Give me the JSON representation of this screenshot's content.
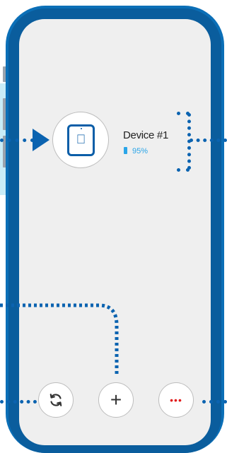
{
  "device": {
    "name": "Device #1",
    "battery_percent": "95%",
    "battery_level": 0.95,
    "icon": "tablet-apple-icon"
  },
  "toolbar": {
    "buttons": [
      {
        "name": "refresh",
        "icon": "refresh-icon"
      },
      {
        "name": "add",
        "icon": "plus-icon",
        "glyph": "+"
      },
      {
        "name": "more",
        "icon": "more-dots-icon",
        "glyph": "•••"
      }
    ]
  },
  "colors": {
    "phone_body": "#0b6fb7",
    "screen_bg": "#efefef",
    "callout_lines": "#0b63b0",
    "battery": "#2aa5e8",
    "more_dots": "#e11b1b"
  }
}
